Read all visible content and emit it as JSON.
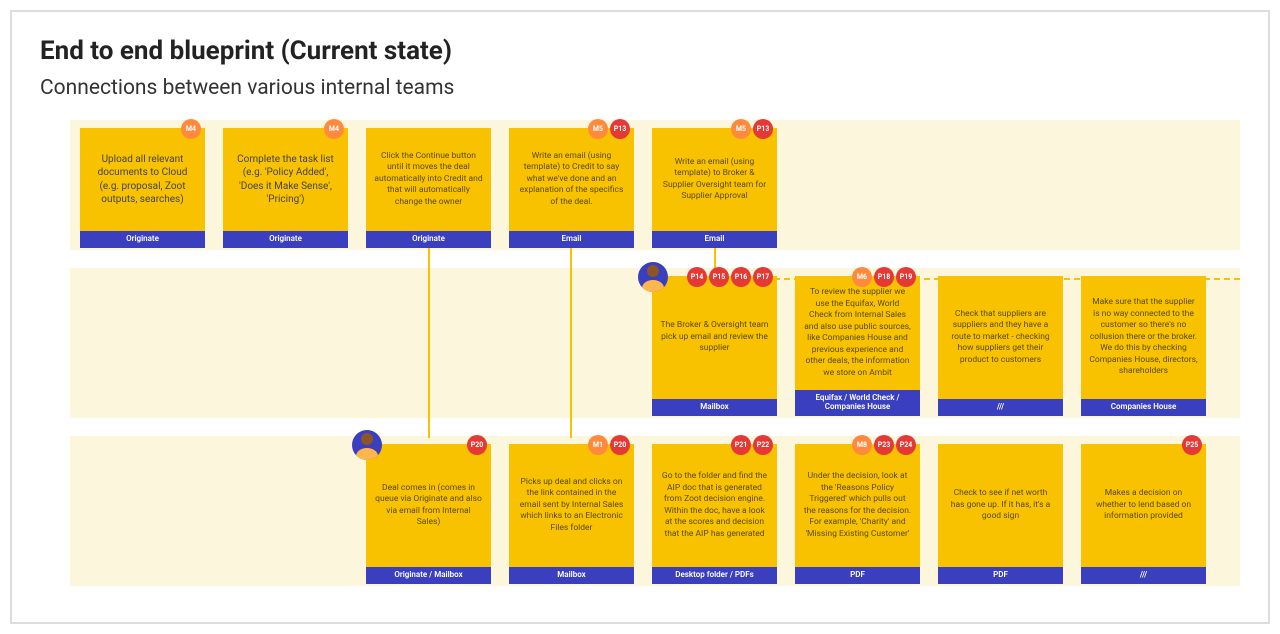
{
  "title": "End to end blueprint (Current state)",
  "subtitle": "Connections between various internal teams",
  "rows": [
    {
      "cards": [
        {
          "col": 0,
          "body": "Upload all relevant documents to Cloud (e.g. proposal, Zoot outputs, searches)",
          "foot": "Originate",
          "badges": [
            {
              "t": "m",
              "l": "M4"
            }
          ]
        },
        {
          "col": 1,
          "body": "Complete the task list (e.g. 'Policy Added', 'Does it Make Sense', 'Pricing')",
          "foot": "Originate",
          "badges": [
            {
              "t": "m",
              "l": "M4"
            }
          ]
        },
        {
          "col": 2,
          "body": "Click the Continue button until it moves the deal automatically into Credit and that will automatically change the owner",
          "foot": "Originate",
          "badges": []
        },
        {
          "col": 3,
          "body": "Write an email (using template) to Credit to say what we've done and an explanation of the specifics of the deal.",
          "foot": "Email",
          "badges": [
            {
              "t": "m",
              "l": "M5"
            },
            {
              "t": "p",
              "l": "P13"
            }
          ]
        },
        {
          "col": 4,
          "body": "Write an email (using template) to Broker & Supplier Oversight team for Supplier Approval",
          "foot": "Email",
          "badges": [
            {
              "t": "m",
              "l": "M5"
            },
            {
              "t": "p",
              "l": "P13"
            }
          ]
        }
      ]
    },
    {
      "cards": [
        {
          "col": 4,
          "body": "The Broker & Oversight team pick up email and review the supplier",
          "foot": "Mailbox",
          "badges": [
            {
              "t": "p",
              "l": "P14"
            },
            {
              "t": "p",
              "l": "P15"
            },
            {
              "t": "p",
              "l": "P16"
            },
            {
              "t": "p",
              "l": "P17"
            }
          ],
          "avatar": true
        },
        {
          "col": 5,
          "body": "To review the supplier we use the Equifax, World Check from Internal Sales and also use public sources, like Companies House and previous experience and other deals, the information we store on Ambit",
          "foot": "Equifax / World Check / Companies House",
          "badges": [
            {
              "t": "m",
              "l": "M6"
            },
            {
              "t": "p",
              "l": "P18"
            },
            {
              "t": "p",
              "l": "P19"
            }
          ]
        },
        {
          "col": 6,
          "body": "Check that suppliers are suppliers and they have a route to market - checking how suppliers get their product to customers",
          "foot": "///",
          "badges": []
        },
        {
          "col": 7,
          "body": "Make sure that the supplier is no way connected to the customer so there's no collusion there or the broker. We do this by checking Companies House, directors, shareholders",
          "foot": "Companies House",
          "badges": []
        }
      ]
    },
    {
      "cards": [
        {
          "col": 2,
          "body": "Deal comes in (comes in queue via Originate and also via email from Internal Sales)",
          "foot": "Originate / Mailbox",
          "badges": [
            {
              "t": "p",
              "l": "P20"
            }
          ],
          "avatar": true
        },
        {
          "col": 3,
          "body": "Picks up deal and clicks on the link contained in the email sent by Internal Sales which links to an Electronic Files folder",
          "foot": "Mailbox",
          "badges": [
            {
              "t": "m",
              "l": "M1"
            },
            {
              "t": "p",
              "l": "P20"
            }
          ]
        },
        {
          "col": 4,
          "body": "Go to the folder and find the AIP doc that is generated from Zoot decision engine. Within the doc, have a look at the scores and decision that the AIP has generated",
          "foot": "Desktop folder / PDFs",
          "badges": [
            {
              "t": "p",
              "l": "P21"
            },
            {
              "t": "p",
              "l": "P22"
            }
          ]
        },
        {
          "col": 5,
          "body": "Under the decision, look at the 'Reasons Policy Triggered' which pulls out the reasons for the decision. For example, 'Charity' and 'Missing Existing Customer'",
          "foot": "PDF",
          "badges": [
            {
              "t": "m",
              "l": "M8"
            },
            {
              "t": "p",
              "l": "P23"
            },
            {
              "t": "p",
              "l": "P24"
            }
          ]
        },
        {
          "col": 6,
          "body": "Check to see if net worth has gone up. If it has, it's a good sign",
          "foot": "PDF",
          "badges": []
        },
        {
          "col": 7,
          "body": "Makes a decision on whether to lend based on information provided",
          "foot": "///",
          "badges": [
            {
              "t": "p",
              "l": "P25"
            }
          ]
        }
      ]
    }
  ]
}
